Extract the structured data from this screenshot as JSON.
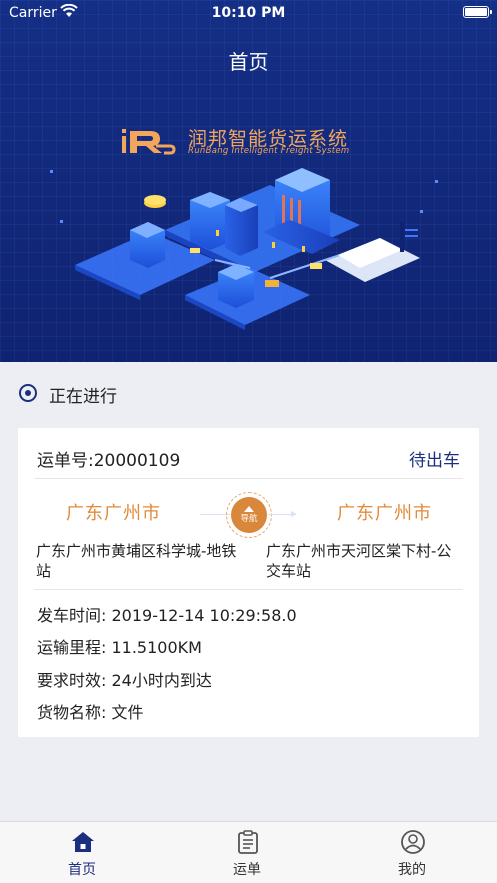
{
  "status_bar": {
    "carrier": "Carrier",
    "time": "10:10 PM"
  },
  "header": {
    "title": "首页"
  },
  "brand": {
    "name_cn": "润邦智能货运系统",
    "name_en": "RunBang Intelligent Freight System"
  },
  "section": {
    "title": "正在进行"
  },
  "order": {
    "number_text": "运单号:20000109",
    "status": "待出车",
    "from_city": "广东广州市",
    "to_city": "广东广州市",
    "nav_label": "导航",
    "from_address": "广东广州市黄埔区科学城-地铁站",
    "to_address": "广东广州市天河区棠下村-公交车站",
    "departure_time": "发车时间: 2019-12-14 10:29:58.0",
    "distance": "运输里程: 11.5100KM",
    "time_limit": "要求时效: 24小时内到达",
    "cargo": "货物名称: 文件"
  },
  "tabbar": {
    "items": [
      {
        "label": "首页",
        "icon": "home-icon",
        "active": true
      },
      {
        "label": "运单",
        "icon": "clipboard-icon",
        "active": false
      },
      {
        "label": "我的",
        "icon": "user-icon",
        "active": false
      }
    ]
  },
  "colors": {
    "primary": "#1c2e7e",
    "accent": "#e08b3a",
    "background": "#eceef3"
  }
}
